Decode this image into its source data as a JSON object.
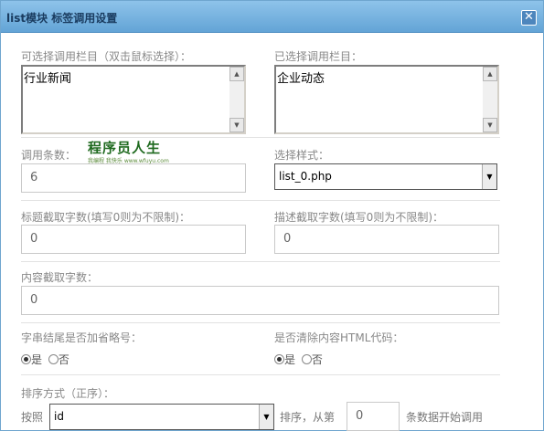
{
  "dialog": {
    "title": "list模块 标签调用设置",
    "close_glyph": "✕"
  },
  "available_columns": {
    "label": "可选择调用栏目（双击鼠标选择）：",
    "items": [
      "行业新闻"
    ]
  },
  "selected_columns": {
    "label": "已选择调用栏目：",
    "items": [
      "企业动态"
    ]
  },
  "count": {
    "label": "调用条数：",
    "value": "6"
  },
  "style": {
    "label": "选择样式：",
    "value": "list_0.php"
  },
  "title_chars": {
    "label": "标题截取字数(填写0则为不限制)：",
    "value": "0"
  },
  "desc_chars": {
    "label": "描述截取字数(填写0则为不限制)：",
    "value": "0"
  },
  "content_chars": {
    "label": "内容截取字数：",
    "value": "0"
  },
  "ellipsis": {
    "label": "字串结尾是否加省略号：",
    "yes": "是",
    "no": "否",
    "selected": "yes"
  },
  "strip_html": {
    "label": "是否清除内容HTML代码：",
    "yes": "是",
    "no": "否",
    "selected": "yes"
  },
  "order": {
    "label": "排序方式（正序）：",
    "by_label": "按照",
    "field": "id",
    "sort_from_label": "排序，从第",
    "start": "0",
    "suffix": "条数据开始调用"
  },
  "watermark": {
    "main": "程序员人生",
    "sub": "我编程 我快乐 www.wfuyu.com"
  }
}
